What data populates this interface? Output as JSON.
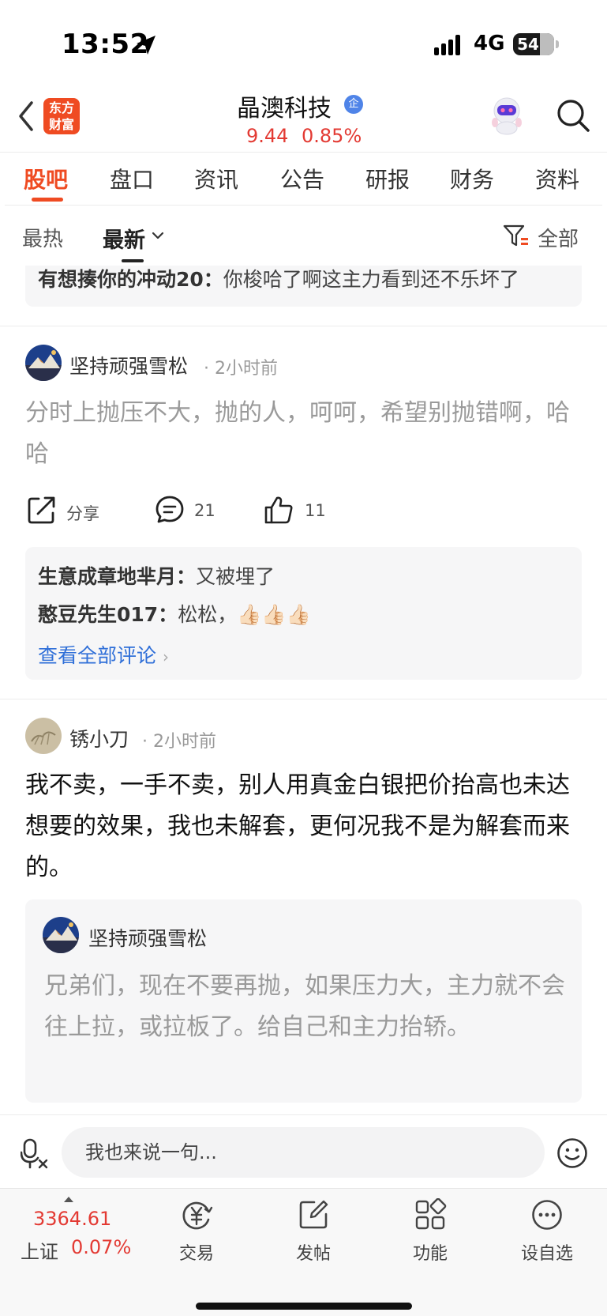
{
  "status_bar": {
    "time": "13:52",
    "network": "4G",
    "battery": "54"
  },
  "header": {
    "logo_text": "东方\n财富",
    "stock_name": "晶澳科技",
    "badge": "企",
    "price": "9.44",
    "change_pct": "0.85%"
  },
  "tabs": [
    "股吧",
    "盘口",
    "资讯",
    "公告",
    "研报",
    "财务",
    "资料"
  ],
  "sort": {
    "hot": "最热",
    "latest": "最新",
    "filter_all": "全部"
  },
  "top_reply": {
    "user": "有想揍你的冲动20：",
    "text": "你梭哈了啊这主力看到还不乐坏了"
  },
  "posts": [
    {
      "user": "坚持顽强雪松",
      "time": "· 2小时前",
      "body": "分时上抛压不大，抛的人，呵呵，希望别抛错啊，哈哈",
      "actions": {
        "share": "分享",
        "comments": "21",
        "likes": "11"
      },
      "replies": [
        {
          "user": "生意成章地芈月：",
          "text": "又被埋了"
        },
        {
          "user": "憨豆先生017：",
          "text": "松松，👍🏻👍🏻👍🏻"
        }
      ],
      "see_all": "查看全部评论"
    },
    {
      "user": "锈小刀",
      "time": "· 2小时前",
      "body": "我不卖，一手不卖，别人用真金白银把价抬高也未达想要的效果，我也未解套，更何况我不是为解套而来的。",
      "quote": {
        "user": "坚持顽强雪松",
        "body": "兄弟们，现在不要再抛，如果压力大，主力就不会往上拉，或拉板了。给自己和主力抬轿。"
      }
    }
  ],
  "input": {
    "placeholder": "我也来说一句..."
  },
  "bottom_nav": {
    "index_value": "3364.61",
    "index_name": "上证",
    "index_change": "0.07%",
    "items": [
      "交易",
      "发帖",
      "功能",
      "设自选"
    ]
  },
  "colors": {
    "accent": "#ef4b22",
    "up": "#e33a33",
    "link": "#2f6fd8"
  }
}
